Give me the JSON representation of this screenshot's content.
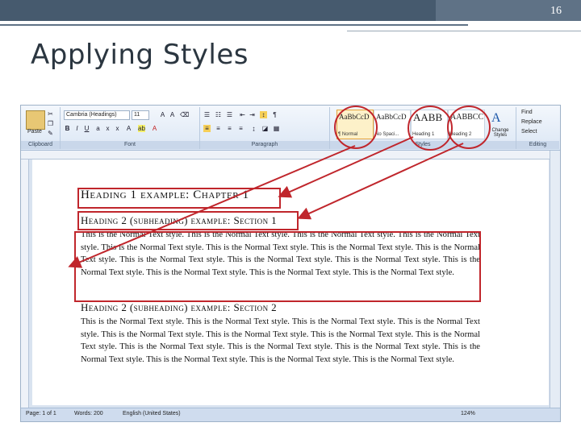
{
  "slide": {
    "number": "16",
    "title": "Applying Styles"
  },
  "ribbon": {
    "clipboard": {
      "paste_label": "Paste",
      "group_label": "Clipboard"
    },
    "font": {
      "font_name": "Cambria (Headings)",
      "font_size": "11",
      "group_label": "Font"
    },
    "paragraph": {
      "group_label": "Paragraph"
    },
    "styles": {
      "group_label": "Styles",
      "items": [
        {
          "sample": "AaBbCcD",
          "name": "¶ Normal"
        },
        {
          "sample": "AaBbCcD",
          "name": "No Spaci..."
        },
        {
          "sample": "AABB",
          "name": "Heading 1"
        },
        {
          "sample": "AABBCC",
          "name": "Heading 2"
        }
      ],
      "change_styles_label": "Change Styles"
    },
    "editing": {
      "group_label": "Editing",
      "find": "Find",
      "replace": "Replace",
      "select": "Select"
    }
  },
  "document": {
    "heading1": "Heading 1 example: Chapter 1",
    "section1_heading": "Heading 2 (subheading) example: Section 1",
    "section1_body": "This is the Normal Text style. This is the Normal Text style. This is the Normal Text style. This is the Normal Text style. This is the Normal Text style. This is the Normal Text style. This is the Normal Text style. This is the Normal Text style. This is the Normal Text style. This is the Normal Text style. This is the Normal Text style. This is the Normal Text style. This is the Normal Text style. This is the Normal Text style. This is the Normal Text style.",
    "section2_heading": "Heading 2 (subheading) example: Section 2",
    "section2_body": "This is the Normal Text style. This is the Normal Text style. This is the Normal Text style. This is the Normal Text style. This is the Normal Text style. This is the Normal Text style. This is the Normal Text style. This is the Normal Text style. This is the Normal Text style. This is the Normal Text style. This is the Normal Text style. This is the Normal Text style. This is the Normal Text style. This is the Normal Text style. This is the Normal Text style."
  },
  "status_bar": {
    "page": "Page: 1 of 1",
    "words": "Words: 200",
    "language": "English (United States)",
    "zoom": "124%"
  },
  "colors": {
    "annotation": "#c0262c",
    "title_bar": "#465a6e"
  }
}
